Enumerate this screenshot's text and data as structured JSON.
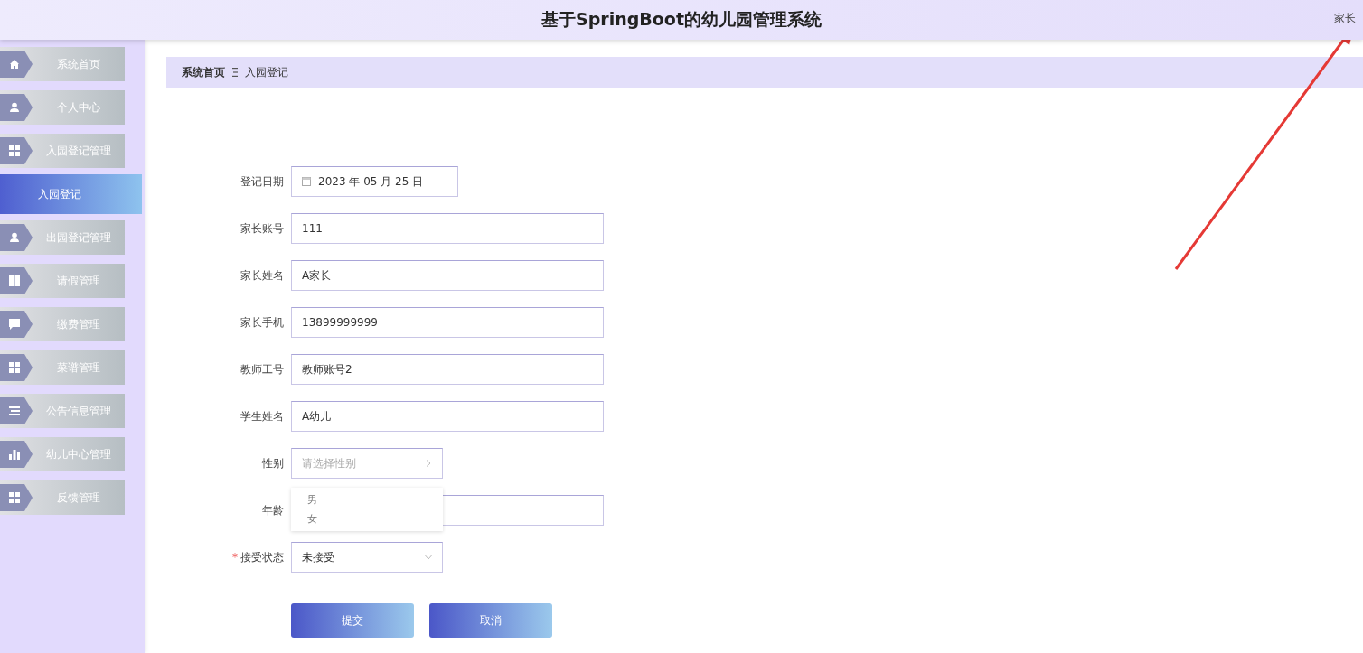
{
  "header": {
    "title": "基于SpringBoot的幼儿园管理系统",
    "user": "家长"
  },
  "sidebar": {
    "items": [
      {
        "label": "系统首页",
        "selected": false
      },
      {
        "label": "个人中心",
        "selected": false
      },
      {
        "label": "入园登记管理",
        "selected": false
      },
      {
        "label": "入园登记",
        "selected": true
      },
      {
        "label": "出园登记管理",
        "selected": false
      },
      {
        "label": "请假管理",
        "selected": false
      },
      {
        "label": "缴费管理",
        "selected": false
      },
      {
        "label": "菜谱管理",
        "selected": false
      },
      {
        "label": "公告信息管理",
        "selected": false
      },
      {
        "label": "幼儿中心管理",
        "selected": false
      },
      {
        "label": "反馈管理",
        "selected": false
      }
    ]
  },
  "breadcrumb": [
    "系统首页",
    "入园登记"
  ],
  "form": {
    "fields": [
      {
        "label": "登记日期",
        "kind": "date",
        "value": "2023 年 05 月 25 日"
      },
      {
        "label": "家长账号",
        "kind": "text",
        "value": "111"
      },
      {
        "label": "家长姓名",
        "kind": "text",
        "value": "A家长"
      },
      {
        "label": "家长手机",
        "kind": "text",
        "value": "13899999999"
      },
      {
        "label": "教师工号",
        "kind": "text",
        "value": "教师账号2"
      },
      {
        "label": "学生姓名",
        "kind": "text",
        "value": "A幼儿"
      },
      {
        "label": "性别",
        "kind": "select",
        "placeholder": "请选择性别",
        "expanded": true,
        "options": [
          "男",
          "女"
        ]
      },
      {
        "label": "年龄",
        "kind": "text"
      },
      {
        "label": "接受状态",
        "kind": "select",
        "value": "未接受",
        "expanded": false,
        "required_mark": "*"
      }
    ],
    "buttons": [
      "提交",
      "取消"
    ]
  }
}
